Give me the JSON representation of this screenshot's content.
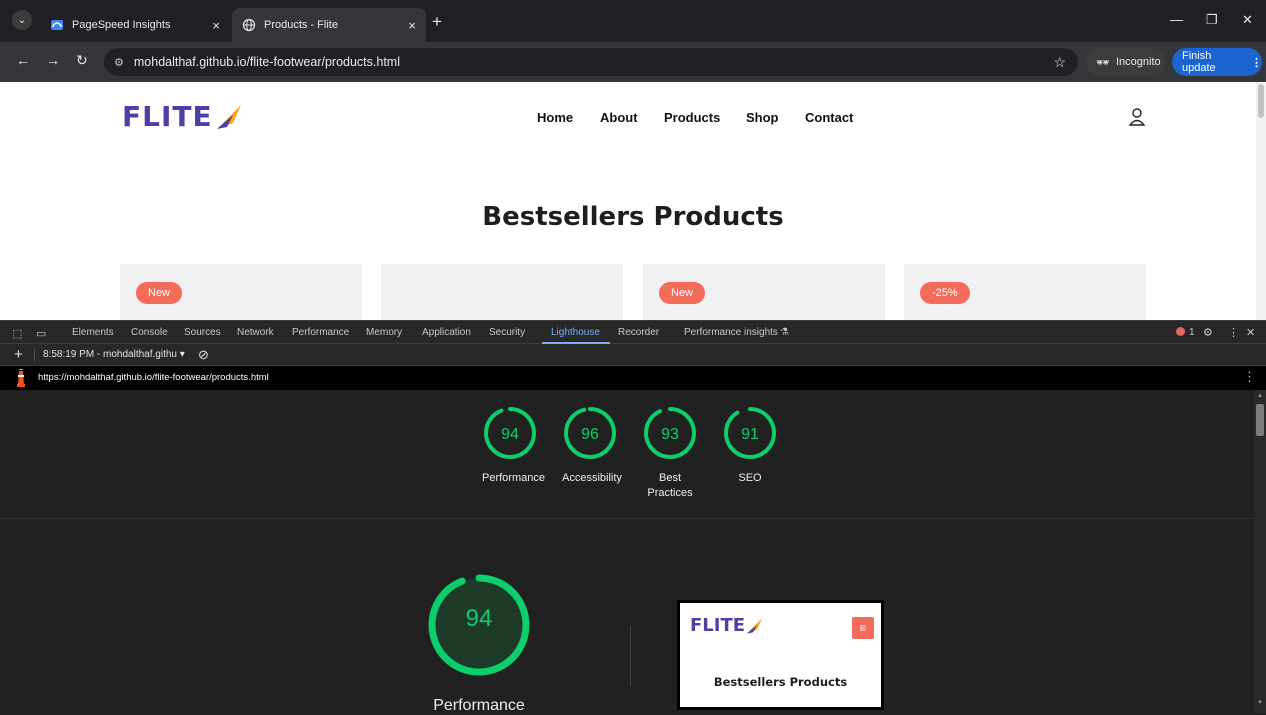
{
  "browser": {
    "tabs": [
      {
        "title": "PageSpeed Insights",
        "close": "×"
      },
      {
        "title": "Products - Flite",
        "close": "×"
      }
    ],
    "new_tab": "+",
    "url": "mohdalthaf.github.io/flite-footwear/products.html",
    "incognito_label": "Incognito",
    "finish_update_label": "Finish update"
  },
  "site": {
    "logo_text": "FLITE",
    "nav": [
      "Home",
      "About",
      "Products",
      "Shop",
      "Contact"
    ],
    "heading": "Bestsellers Products",
    "cards": [
      {
        "badge": "New"
      },
      {
        "badge": ""
      },
      {
        "badge": "New"
      },
      {
        "badge": "-25%"
      }
    ]
  },
  "devtools": {
    "tabs": [
      "Elements",
      "Console",
      "Sources",
      "Network",
      "Performance",
      "Memory",
      "Application",
      "Security",
      "Lighthouse",
      "Recorder",
      "Performance insights"
    ],
    "active_tab": "Lighthouse",
    "error_count": "1",
    "report_label": "8:58:19 PM - mohdalthaf.githu",
    "report_url": "https://mohdalthaf.github.io/flite-footwear/products.html"
  },
  "lighthouse": {
    "scores": [
      {
        "value": "94",
        "label": "Performance",
        "fraction": 0.94
      },
      {
        "value": "96",
        "label": "Accessibility",
        "fraction": 0.96
      },
      {
        "value": "93",
        "label": "Best Practices",
        "fraction": 0.93
      },
      {
        "value": "91",
        "label": "SEO",
        "fraction": 0.91
      }
    ],
    "main_score": {
      "value": "94",
      "label": "Performance",
      "fraction": 0.94
    },
    "screenshot": {
      "logo_text": "FLITE",
      "heading": "Bestsellers Products"
    },
    "score_color": "#0cce6b"
  }
}
